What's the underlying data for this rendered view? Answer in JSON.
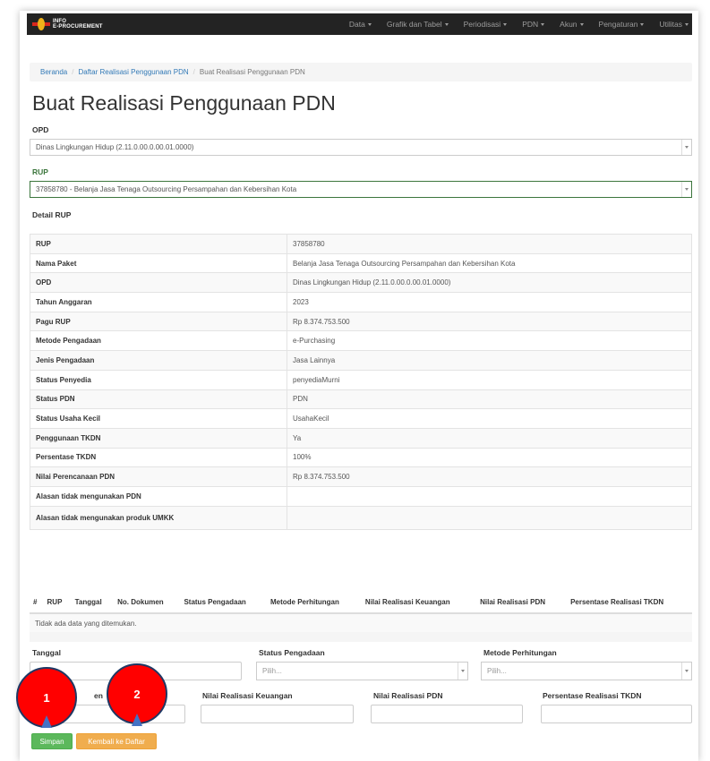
{
  "navbar": {
    "brand_line1": "INFO",
    "brand_line2": "E-PROCUREMENT",
    "menu": [
      "Data",
      "Grafik dan Tabel",
      "Periodisasi",
      "PDN",
      "Akun",
      "Pengaturan",
      "Utilitas"
    ]
  },
  "breadcrumb": {
    "items": [
      "Beranda",
      "Daftar Realisasi Penggunaan PDN"
    ],
    "active": "Buat Realisasi Penggunaan PDN"
  },
  "page_title": "Buat Realisasi Penggunaan PDN",
  "form": {
    "opd_label": "OPD",
    "opd_value": "Dinas Lingkungan Hidup (2.11.0.00.0.00.01.0000)",
    "rup_label": "RUP",
    "rup_value": "37858780 - Belanja Jasa Tenaga Outsourcing Persampahan dan Kebersihan Kota",
    "detail_label": "Detail RUP"
  },
  "detail_rows": [
    {
      "key": "RUP",
      "value": "37858780"
    },
    {
      "key": "Nama Paket",
      "value": "Belanja Jasa Tenaga Outsourcing Persampahan dan Kebersihan Kota"
    },
    {
      "key": "OPD",
      "value": "Dinas Lingkungan Hidup (2.11.0.00.0.00.01.0000)"
    },
    {
      "key": "Tahun Anggaran",
      "value": "2023"
    },
    {
      "key": "Pagu RUP",
      "value": "Rp 8.374.753.500"
    },
    {
      "key": "Metode Pengadaan",
      "value": "e-Purchasing"
    },
    {
      "key": "Jenis Pengadaan",
      "value": "Jasa Lainnya"
    },
    {
      "key": "Status Penyedia",
      "value": "penyediaMurni"
    },
    {
      "key": "Status PDN",
      "value": "PDN"
    },
    {
      "key": "Status Usaha Kecil",
      "value": "UsahaKecil"
    },
    {
      "key": "Penggunaan TKDN",
      "value": "Ya"
    },
    {
      "key": "Persentase TKDN",
      "value": "100%"
    },
    {
      "key": "Nilai Perencanaan PDN",
      "value": "Rp 8.374.753.500"
    },
    {
      "key": "Alasan tidak mengunakan PDN",
      "value": ""
    },
    {
      "key": "Alasan tidak mengunakan produk UMKK",
      "value": ""
    }
  ],
  "list_table": {
    "headers": [
      "#",
      "RUP",
      "Tanggal",
      "No. Dokumen",
      "Status Pengadaan",
      "Metode Perhitungan",
      "Nilai Realisasi Keuangan",
      "Nilai Realisasi PDN",
      "Persentase Realisasi TKDN"
    ],
    "empty_message": "Tidak ada data yang ditemukan."
  },
  "entry_form": {
    "tanggal_label": "Tanggal",
    "status_label": "Status Pengadaan",
    "status_placeholder": "Pilih...",
    "metode_label": "Metode Perhitungan",
    "metode_placeholder": "Pilih...",
    "dokumen_label_partial": "en",
    "keuangan_label": "Nilai Realisasi Keuangan",
    "pdn_label": "Nilai Realisasi PDN",
    "tkdn_label": "Persentase Realisasi TKDN"
  },
  "buttons": {
    "save": "Simpan",
    "back": "Kembali ke Daftar"
  },
  "callouts": [
    "1",
    "2"
  ],
  "colors": {
    "navbar": "#232323",
    "success": "#5cb85c",
    "warning": "#f0ad4e",
    "callout": "#ff0000",
    "pointer": "#4472c4"
  }
}
